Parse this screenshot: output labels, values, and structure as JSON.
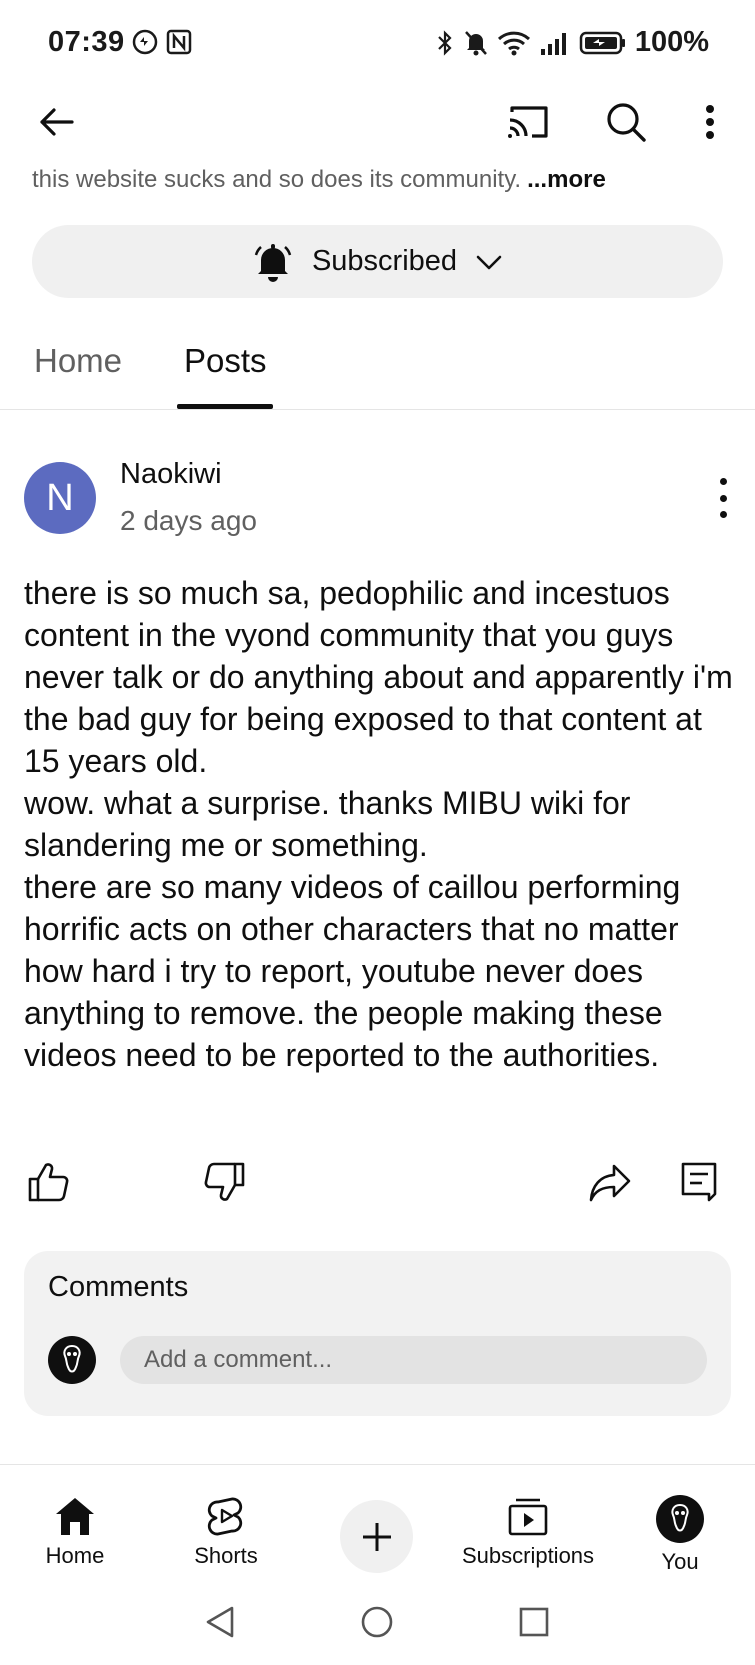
{
  "status_bar": {
    "time": "07:39",
    "battery": "100%",
    "left_icons": [
      "auto-sync-icon",
      "nfc-icon"
    ],
    "right_icons": [
      "bluetooth-icon",
      "silent-bell-icon",
      "wifi-icon",
      "signal-icon",
      "battery-saver-icon"
    ]
  },
  "top_bar": {
    "icons": [
      "back-arrow-icon",
      "cast-icon",
      "search-icon",
      "more-vert-icon"
    ]
  },
  "channel": {
    "description": "this website sucks and so does its community.",
    "more_label": "...more",
    "subscribe_label": "Subscribed",
    "subscribe_icon": "notification-bell-icon"
  },
  "tabs": [
    {
      "label": "Home",
      "active": false
    },
    {
      "label": "Posts",
      "active": true
    }
  ],
  "post": {
    "avatar_letter": "N",
    "avatar_color": "#5c6bc0",
    "author": "Naokiwi",
    "time": "2 days ago",
    "paragraphs": [
      "there is so much sa, pedophilic and incestuos content in the vyond community that you guys never talk or do anything about and apparently i'm the bad guy for being exposed to that content at 15 years old.",
      "wow. what a surprise. thanks MIBU wiki for slandering me or something.",
      "there are so many videos of caillou performing horrific acts on other characters that no matter how hard i try to report, youtube never does anything to remove. the people making these videos need to be reported to the authorities."
    ],
    "actions": [
      "like-icon",
      "dislike-icon",
      "share-icon",
      "comment-icon"
    ]
  },
  "comments": {
    "title": "Comments",
    "placeholder": "Add a comment..."
  },
  "bottom_nav": [
    {
      "label": "Home",
      "icon": "home-icon"
    },
    {
      "label": "Shorts",
      "icon": "shorts-icon"
    },
    {
      "label": "",
      "icon": "create-plus-icon"
    },
    {
      "label": "Subscriptions",
      "icon": "subscriptions-icon"
    },
    {
      "label": "You",
      "icon": "avatar"
    }
  ],
  "system_nav": [
    "back-triangle-icon",
    "home-circle-icon",
    "recents-square-icon"
  ]
}
